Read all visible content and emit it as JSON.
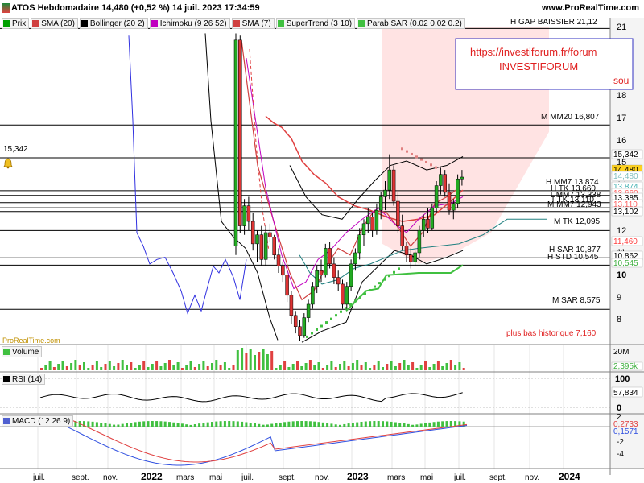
{
  "header": {
    "title": "ATOS Hebdomadaire 14,480 (+0,52 %) 14 juil. 2023 17:34:59",
    "site": "www.ProRealTime.com"
  },
  "legend": [
    {
      "label": "Prix",
      "color": "#00a000"
    },
    {
      "label": "SMA (20)",
      "color": "#d04040"
    },
    {
      "label": "Bollinger (20 2)",
      "color": "#000000"
    },
    {
      "label": "Ichimoku (9 26 52)",
      "color": "#c000c0"
    },
    {
      "label": "SMA (7)",
      "color": "#d04040"
    },
    {
      "label": "SuperTrend (3 10)",
      "color": "#40c040"
    },
    {
      "label": "Parab SAR (0.02 0.02 0.2)",
      "color": "#40c040"
    }
  ],
  "annotations": {
    "gap": "H GAP BAISSIER 21,12",
    "url": "https://investiforum.fr/forum",
    "brand": "INVESTIFORUM",
    "sou": "sou",
    "mm20": "M MM20 16,807",
    "mm7_h": "H MM7 13,874",
    "tk_h": "H TK 13,660",
    "mm7_t": "T MM7 13,338",
    "tk_t": "T TK 13,110",
    "mm7_m": "M MM7 12,943",
    "tk_m": "M TK 12,095",
    "sar_h": "H SAR 10,877",
    "std_h": "H STD 10,545",
    "sar_m": "M SAR 8,575",
    "low": "plus bas historique 7,160",
    "left_level": "15,342",
    "watermark": "ProRealTime.com"
  },
  "price_axis": {
    "ticks": [
      "21",
      "20",
      "19",
      "18",
      "17",
      "16",
      "15",
      "14",
      "13",
      "12",
      "11",
      "10",
      "9",
      "8"
    ],
    "tags": [
      {
        "text": "15,342",
        "bg": "#ffffff",
        "color": "#000000"
      },
      {
        "text": "14,480",
        "bg": "#ffd21e",
        "color": "#000000"
      },
      {
        "text": "14,480",
        "bg": "#ffffff",
        "color": "#80c0c0"
      },
      {
        "text": "13,874",
        "bg": "#ffffff",
        "color": "#40b0b0"
      },
      {
        "text": "13,660",
        "bg": "#ffffff",
        "color": "#ff6060"
      },
      {
        "text": "13,385",
        "bg": "#ffffff",
        "color": "#000000"
      },
      {
        "text": "13,110",
        "bg": "#ffffff",
        "color": "#ff6060"
      },
      {
        "text": "13,102",
        "bg": "#ffffff",
        "color": "#000000"
      },
      {
        "text": "11,460",
        "bg": "#ffffff",
        "color": "#ff4040"
      },
      {
        "text": "10,862",
        "bg": "#ffffff",
        "color": "#000000"
      },
      {
        "text": "10,545",
        "bg": "#ffffff",
        "color": "#40b040"
      }
    ]
  },
  "time_axis": [
    "juil.",
    "sept.",
    "nov.",
    "2022",
    "mars",
    "mai",
    "juil.",
    "sept.",
    "nov.",
    "2023",
    "mars",
    "mai",
    "juil.",
    "sept.",
    "nov.",
    "2024"
  ],
  "panels": {
    "volume": {
      "label": "Volume",
      "ticks": [
        "20M",
        "2,395k"
      ]
    },
    "rsi": {
      "label": "RSI (14)",
      "ticks": [
        "100",
        "57,834",
        "0"
      ]
    },
    "macd": {
      "label": "MACD (12 26 9)",
      "ticks": [
        "2",
        "0,2733",
        "0,1571",
        "-2",
        "-4"
      ]
    }
  },
  "chart_data": {
    "type": "candlestick",
    "title": "ATOS Hebdomadaire 14,480 (+0,52 %) 14 juil. 2023 17:34:59",
    "price_range": [
      7.0,
      21.6
    ],
    "last_close": 14.48,
    "candles": [
      {
        "t": "2022-07-01",
        "o": 11.4,
        "h": 20.9,
        "l": 11.0,
        "c": 20.6
      },
      {
        "t": "2022-07-08",
        "o": 20.6,
        "h": 20.8,
        "l": 12.0,
        "c": 12.3
      },
      {
        "t": "2022-07-15",
        "o": 12.3,
        "h": 13.5,
        "l": 11.9,
        "c": 13.2
      },
      {
        "t": "2022-07-22",
        "o": 13.2,
        "h": 13.6,
        "l": 12.1,
        "c": 12.5
      },
      {
        "t": "2022-07-29",
        "o": 12.5,
        "h": 12.9,
        "l": 11.2,
        "c": 11.5
      },
      {
        "t": "2022-08-05",
        "o": 11.5,
        "h": 12.1,
        "l": 10.7,
        "c": 11.9
      },
      {
        "t": "2022-08-12",
        "o": 11.9,
        "h": 12.3,
        "l": 10.5,
        "c": 10.8
      },
      {
        "t": "2022-08-19",
        "o": 10.8,
        "h": 12.3,
        "l": 10.5,
        "c": 12.0
      },
      {
        "t": "2022-08-26",
        "o": 12.0,
        "h": 12.4,
        "l": 11.6,
        "c": 11.8
      },
      {
        "t": "2022-09-02",
        "o": 11.8,
        "h": 11.9,
        "l": 10.8,
        "c": 11.0
      },
      {
        "t": "2022-09-09",
        "o": 11.0,
        "h": 11.3,
        "l": 10.2,
        "c": 10.5
      },
      {
        "t": "2022-09-16",
        "o": 10.5,
        "h": 10.7,
        "l": 9.8,
        "c": 10.1
      },
      {
        "t": "2022-09-23",
        "o": 10.1,
        "h": 10.3,
        "l": 8.9,
        "c": 9.2
      },
      {
        "t": "2022-09-30",
        "o": 9.2,
        "h": 9.4,
        "l": 7.9,
        "c": 8.3
      },
      {
        "t": "2022-10-07",
        "o": 8.3,
        "h": 8.5,
        "l": 7.5,
        "c": 7.8
      },
      {
        "t": "2022-10-14",
        "o": 7.8,
        "h": 8.1,
        "l": 7.16,
        "c": 7.4
      },
      {
        "t": "2022-10-21",
        "o": 7.4,
        "h": 8.4,
        "l": 7.3,
        "c": 8.2
      },
      {
        "t": "2022-10-28",
        "o": 8.2,
        "h": 9.0,
        "l": 8.0,
        "c": 8.8
      },
      {
        "t": "2022-11-04",
        "o": 8.8,
        "h": 9.8,
        "l": 8.6,
        "c": 9.6
      },
      {
        "t": "2022-11-11",
        "o": 9.6,
        "h": 10.5,
        "l": 9.3,
        "c": 10.3
      },
      {
        "t": "2022-11-18",
        "o": 10.3,
        "h": 10.8,
        "l": 9.8,
        "c": 10.1
      },
      {
        "t": "2022-11-25",
        "o": 10.1,
        "h": 11.5,
        "l": 10.0,
        "c": 11.3
      },
      {
        "t": "2022-12-02",
        "o": 11.3,
        "h": 11.6,
        "l": 10.4,
        "c": 10.6
      },
      {
        "t": "2022-12-09",
        "o": 10.6,
        "h": 10.9,
        "l": 9.7,
        "c": 10.0
      },
      {
        "t": "2022-12-16",
        "o": 10.0,
        "h": 10.3,
        "l": 9.4,
        "c": 9.7
      },
      {
        "t": "2022-12-23",
        "o": 9.7,
        "h": 9.9,
        "l": 8.6,
        "c": 8.8
      },
      {
        "t": "2022-12-30",
        "o": 8.8,
        "h": 9.8,
        "l": 8.6,
        "c": 9.6
      },
      {
        "t": "2023-01-06",
        "o": 9.6,
        "h": 10.8,
        "l": 9.4,
        "c": 10.6
      },
      {
        "t": "2023-01-13",
        "o": 10.6,
        "h": 11.3,
        "l": 10.3,
        "c": 11.1
      },
      {
        "t": "2023-01-20",
        "o": 11.1,
        "h": 12.2,
        "l": 10.8,
        "c": 11.9
      },
      {
        "t": "2023-01-27",
        "o": 11.9,
        "h": 12.6,
        "l": 11.4,
        "c": 12.4
      },
      {
        "t": "2023-02-03",
        "o": 12.4,
        "h": 13.1,
        "l": 12.0,
        "c": 12.7
      },
      {
        "t": "2023-02-10",
        "o": 12.7,
        "h": 12.9,
        "l": 11.8,
        "c": 12.1
      },
      {
        "t": "2023-02-17",
        "o": 12.1,
        "h": 13.3,
        "l": 11.9,
        "c": 13.0
      },
      {
        "t": "2023-02-24",
        "o": 13.0,
        "h": 13.8,
        "l": 12.6,
        "c": 13.6
      },
      {
        "t": "2023-03-03",
        "o": 13.6,
        "h": 14.3,
        "l": 13.0,
        "c": 13.9
      },
      {
        "t": "2023-03-10",
        "o": 13.9,
        "h": 15.5,
        "l": 13.5,
        "c": 14.8
      },
      {
        "t": "2023-03-17",
        "o": 14.8,
        "h": 15.0,
        "l": 13.2,
        "c": 13.4
      },
      {
        "t": "2023-03-24",
        "o": 13.4,
        "h": 13.8,
        "l": 12.0,
        "c": 12.3
      },
      {
        "t": "2023-03-31",
        "o": 12.3,
        "h": 12.8,
        "l": 11.2,
        "c": 11.4
      },
      {
        "t": "2023-04-07",
        "o": 11.4,
        "h": 11.6,
        "l": 10.7,
        "c": 11.0
      },
      {
        "t": "2023-04-14",
        "o": 11.0,
        "h": 11.3,
        "l": 10.4,
        "c": 10.7
      },
      {
        "t": "2023-04-21",
        "o": 10.7,
        "h": 11.2,
        "l": 10.5,
        "c": 11.1
      },
      {
        "t": "2023-04-28",
        "o": 11.1,
        "h": 12.3,
        "l": 10.9,
        "c": 12.1
      },
      {
        "t": "2023-05-05",
        "o": 12.1,
        "h": 12.8,
        "l": 11.8,
        "c": 12.6
      },
      {
        "t": "2023-05-12",
        "o": 12.6,
        "h": 13.1,
        "l": 12.0,
        "c": 12.2
      },
      {
        "t": "2023-05-19",
        "o": 12.2,
        "h": 13.3,
        "l": 12.1,
        "c": 13.1
      },
      {
        "t": "2023-05-26",
        "o": 13.1,
        "h": 14.3,
        "l": 12.9,
        "c": 14.1
      },
      {
        "t": "2023-06-02",
        "o": 14.1,
        "h": 14.9,
        "l": 13.7,
        "c": 14.6
      },
      {
        "t": "2023-06-09",
        "o": 14.6,
        "h": 14.8,
        "l": 13.6,
        "c": 13.8
      },
      {
        "t": "2023-06-16",
        "o": 13.8,
        "h": 14.2,
        "l": 12.8,
        "c": 13.0
      },
      {
        "t": "2023-06-23",
        "o": 13.0,
        "h": 13.5,
        "l": 12.6,
        "c": 13.3
      },
      {
        "t": "2023-06-30",
        "o": 13.3,
        "h": 14.6,
        "l": 13.1,
        "c": 14.4
      },
      {
        "t": "2023-07-07",
        "o": 14.4,
        "h": 14.8,
        "l": 14.1,
        "c": 14.48
      }
    ],
    "levels": [
      {
        "label": "H GAP BAISSIER 21,12",
        "value": 21.12
      },
      {
        "label": "M MM20 16,807",
        "value": 16.807
      },
      {
        "label": "15,342",
        "value": 15.342
      },
      {
        "label": "H MM7 13,874",
        "value": 13.874
      },
      {
        "label": "H TK 13,660",
        "value": 13.66
      },
      {
        "label": "T MM7 13,338",
        "value": 13.338
      },
      {
        "label": "T TK 13,110",
        "value": 13.11
      },
      {
        "label": "M MM7 12,943",
        "value": 12.943
      },
      {
        "label": "M TK 12,095",
        "value": 12.095
      },
      {
        "label": "H SAR 10,877",
        "value": 10.877
      },
      {
        "label": "H STD 10,545",
        "value": 10.545
      },
      {
        "label": "M SAR 8,575",
        "value": 8.575
      },
      {
        "label": "plus bas historique 7,160",
        "value": 7.16
      }
    ]
  }
}
